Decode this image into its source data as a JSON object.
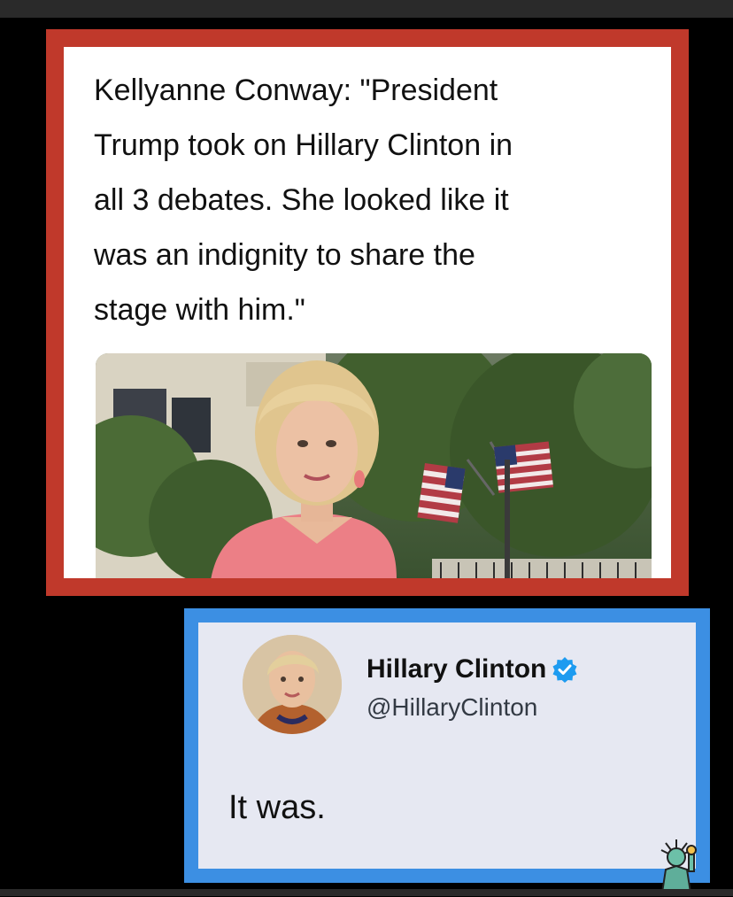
{
  "quote_card": {
    "text": "Kellyanne Conway: \"President\nTrump took on Hillary Clinton in\nall 3 debates. She looked like it\nwas an indignity to share the\nstage with him.\"",
    "border_color": "#c0392b"
  },
  "tweet_card": {
    "name": "Hillary Clinton",
    "handle": "@HillaryClinton",
    "text": "It was.",
    "border_color": "#3c8fe3",
    "verified_color": "#1d9bf0"
  },
  "icons": {
    "verified": "verified-badge-icon",
    "watermark": "statue-of-liberty-icon"
  }
}
